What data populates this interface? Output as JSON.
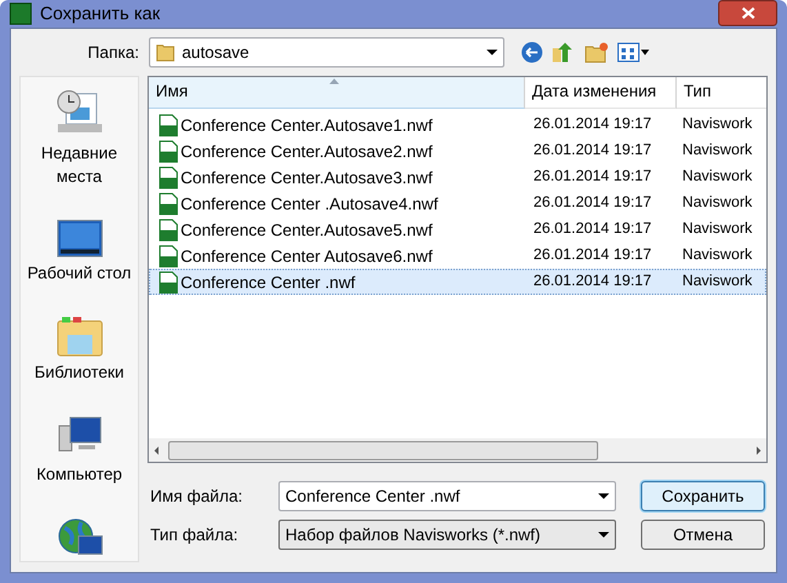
{
  "window": {
    "title": "Сохранить как"
  },
  "folder": {
    "label": "Папка:",
    "value": "autosave"
  },
  "places": [
    {
      "kind": "recent",
      "label": "Недавние места"
    },
    {
      "kind": "desktop",
      "label": "Рабочий стол"
    },
    {
      "kind": "libraries",
      "label": "Библиотеки"
    },
    {
      "kind": "computer",
      "label": "Компьютер"
    },
    {
      "kind": "network"
    }
  ],
  "table": {
    "columns": [
      {
        "label": "Имя",
        "sorted": true
      },
      {
        "label": "Дата изменения",
        "sorted": false
      },
      {
        "label": "Тип",
        "sorted": false
      }
    ],
    "rows": [
      {
        "name": "Conference Center.Autosave1.nwf",
        "date": "26.01.2014 19:17",
        "type": "Naviswork",
        "selected": false
      },
      {
        "name": "Conference Center.Autosave2.nwf",
        "date": "26.01.2014 19:17",
        "type": "Naviswork",
        "selected": false
      },
      {
        "name": "Conference Center.Autosave3.nwf",
        "date": "26.01.2014 19:17",
        "type": "Naviswork",
        "selected": false
      },
      {
        "name": "Conference Center .Autosave4.nwf",
        "date": "26.01.2014 19:17",
        "type": "Naviswork",
        "selected": false
      },
      {
        "name": "Conference Center.Autosave5.nwf",
        "date": "26.01.2014 19:17",
        "type": "Naviswork",
        "selected": false
      },
      {
        "name": "Conference Center Autosave6.nwf",
        "date": "26.01.2014 19:17",
        "type": "Naviswork",
        "selected": false
      },
      {
        "name": "Conference Center .nwf",
        "date": "26.01.2014 19:17",
        "type": "Naviswork",
        "selected": true
      }
    ]
  },
  "file_name": {
    "label": "Имя файла:",
    "value": "Conference Center .nwf"
  },
  "file_type": {
    "label": "Тип файла:",
    "value": "Набор файлов Navisworks (*.nwf)"
  },
  "buttons": [
    {
      "label": "Сохранить",
      "default": true
    },
    {
      "label": "Отмена",
      "default": false
    }
  ]
}
